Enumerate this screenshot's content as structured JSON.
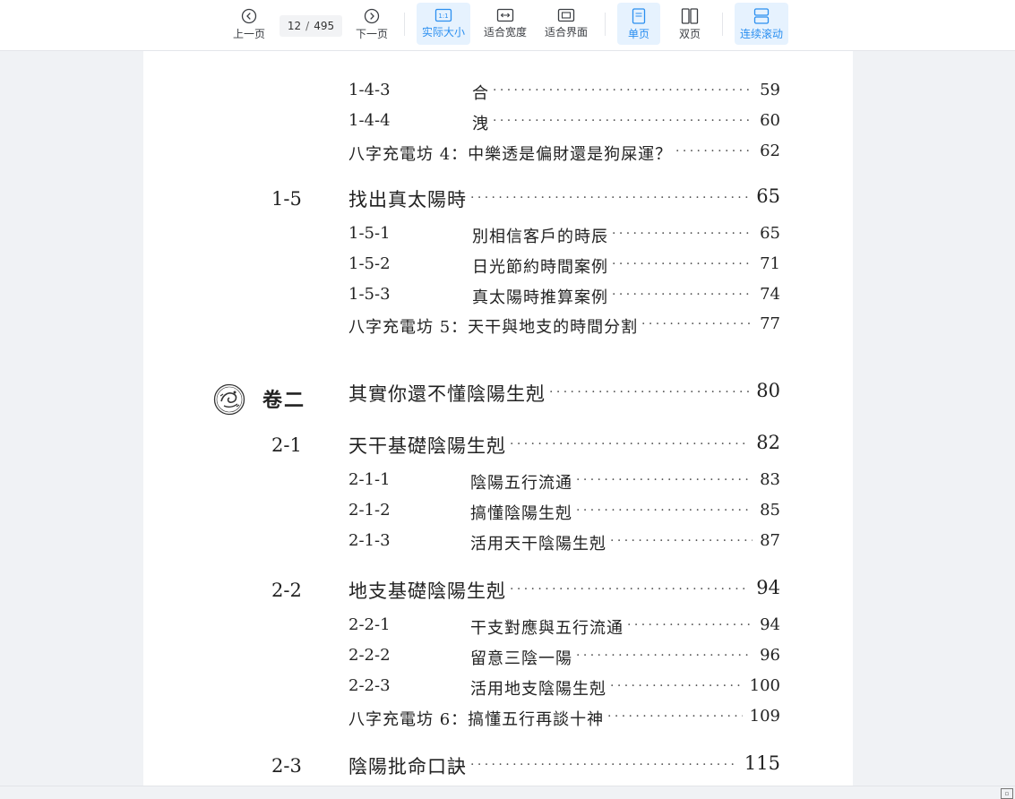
{
  "toolbar": {
    "prev_page": "上一页",
    "page_current": "12",
    "page_separator": "/",
    "page_total": "495",
    "next_page": "下一页",
    "actual_size": "实际大小",
    "actual_size_icon_text": "1:1",
    "fit_width": "适合宽度",
    "fit_page": "适合界面",
    "single_page": "单页",
    "double_page": "双页",
    "continuous_scroll": "连续滚动",
    "active_color": "#2b8ff0"
  },
  "document": {
    "volume_label": "卷二",
    "entries": [
      {
        "num": "1-4-3",
        "title": "合",
        "page": "59"
      },
      {
        "num": "1-4-4",
        "title": "洩",
        "page": "60"
      },
      {
        "num": "",
        "title": "八字充電坊 4：中樂透是偏財還是狗屎運？",
        "page": "62"
      },
      {
        "num": "1-5",
        "title": "找出真太陽時",
        "page": "65"
      },
      {
        "num": "1-5-1",
        "title": "別相信客戶的時辰",
        "page": "65"
      },
      {
        "num": "1-5-2",
        "title": "日光節約時間案例",
        "page": "71"
      },
      {
        "num": "1-5-3",
        "title": "真太陽時推算案例",
        "page": "74"
      },
      {
        "num": "",
        "title": "八字充電坊 5：天干與地支的時間分割",
        "page": "77"
      },
      {
        "num": "",
        "title": "其實你還不懂陰陽生剋",
        "page": "80"
      },
      {
        "num": "2-1",
        "title": "天干基礎陰陽生剋",
        "page": "82"
      },
      {
        "num": "2-1-1",
        "title": "陰陽五行流通",
        "page": "83"
      },
      {
        "num": "2-1-2",
        "title": "搞懂陰陽生剋",
        "page": "85"
      },
      {
        "num": "2-1-3",
        "title": "活用天干陰陽生剋",
        "page": "87"
      },
      {
        "num": "2-2",
        "title": "地支基礎陰陽生剋",
        "page": "94"
      },
      {
        "num": "2-2-1",
        "title": "干支對應與五行流通",
        "page": "94"
      },
      {
        "num": "2-2-2",
        "title": "留意三陰一陽",
        "page": "96"
      },
      {
        "num": "2-2-3",
        "title": "活用地支陰陽生剋",
        "page": "100"
      },
      {
        "num": "",
        "title": "八字充電坊 6：搞懂五行再談十神",
        "page": "109"
      },
      {
        "num": "2-3",
        "title": "陰陽批命口訣",
        "page": "115"
      }
    ]
  },
  "statusbar": {
    "icon": "fullscreen-icon"
  }
}
